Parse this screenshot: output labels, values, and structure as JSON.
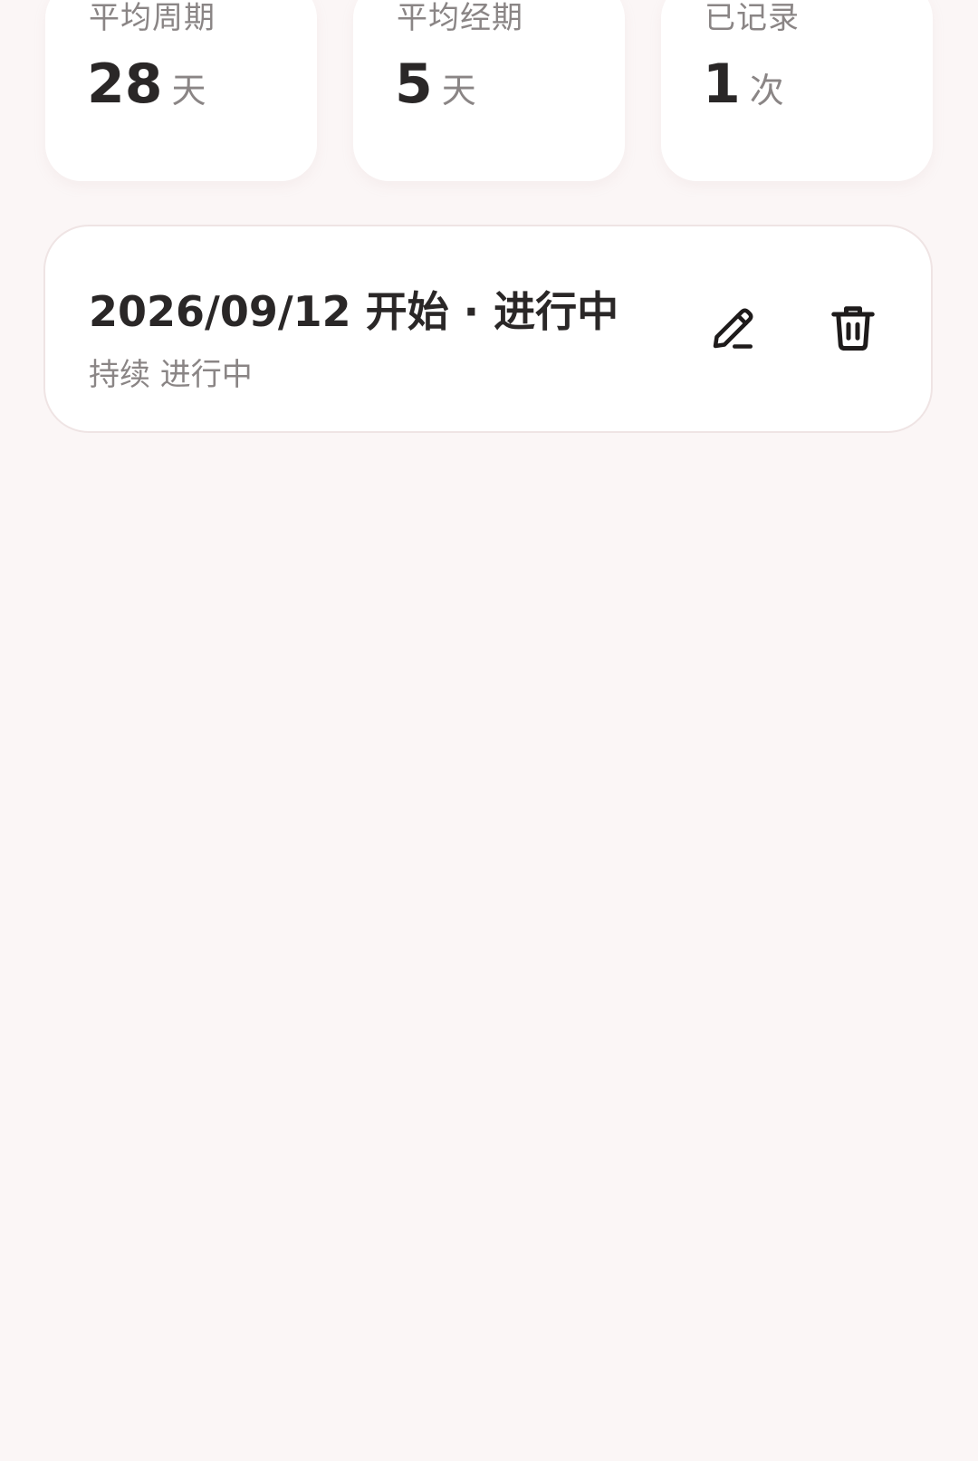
{
  "stats": [
    {
      "label": "平均周期",
      "value": "28",
      "unit": "天"
    },
    {
      "label": "平均经期",
      "value": "5",
      "unit": "天"
    },
    {
      "label": "已记录",
      "value": "1",
      "unit": "次"
    }
  ],
  "record": {
    "title": "2026/09/12 开始 · 进行中",
    "subtitle": "持续 进行中",
    "edit_icon": "pencil-icon",
    "delete_icon": "trash-icon"
  },
  "colors": {
    "background": "#fbf6f6",
    "card": "#ffffff",
    "text_primary": "#2a2727",
    "text_secondary": "#8a8585"
  }
}
